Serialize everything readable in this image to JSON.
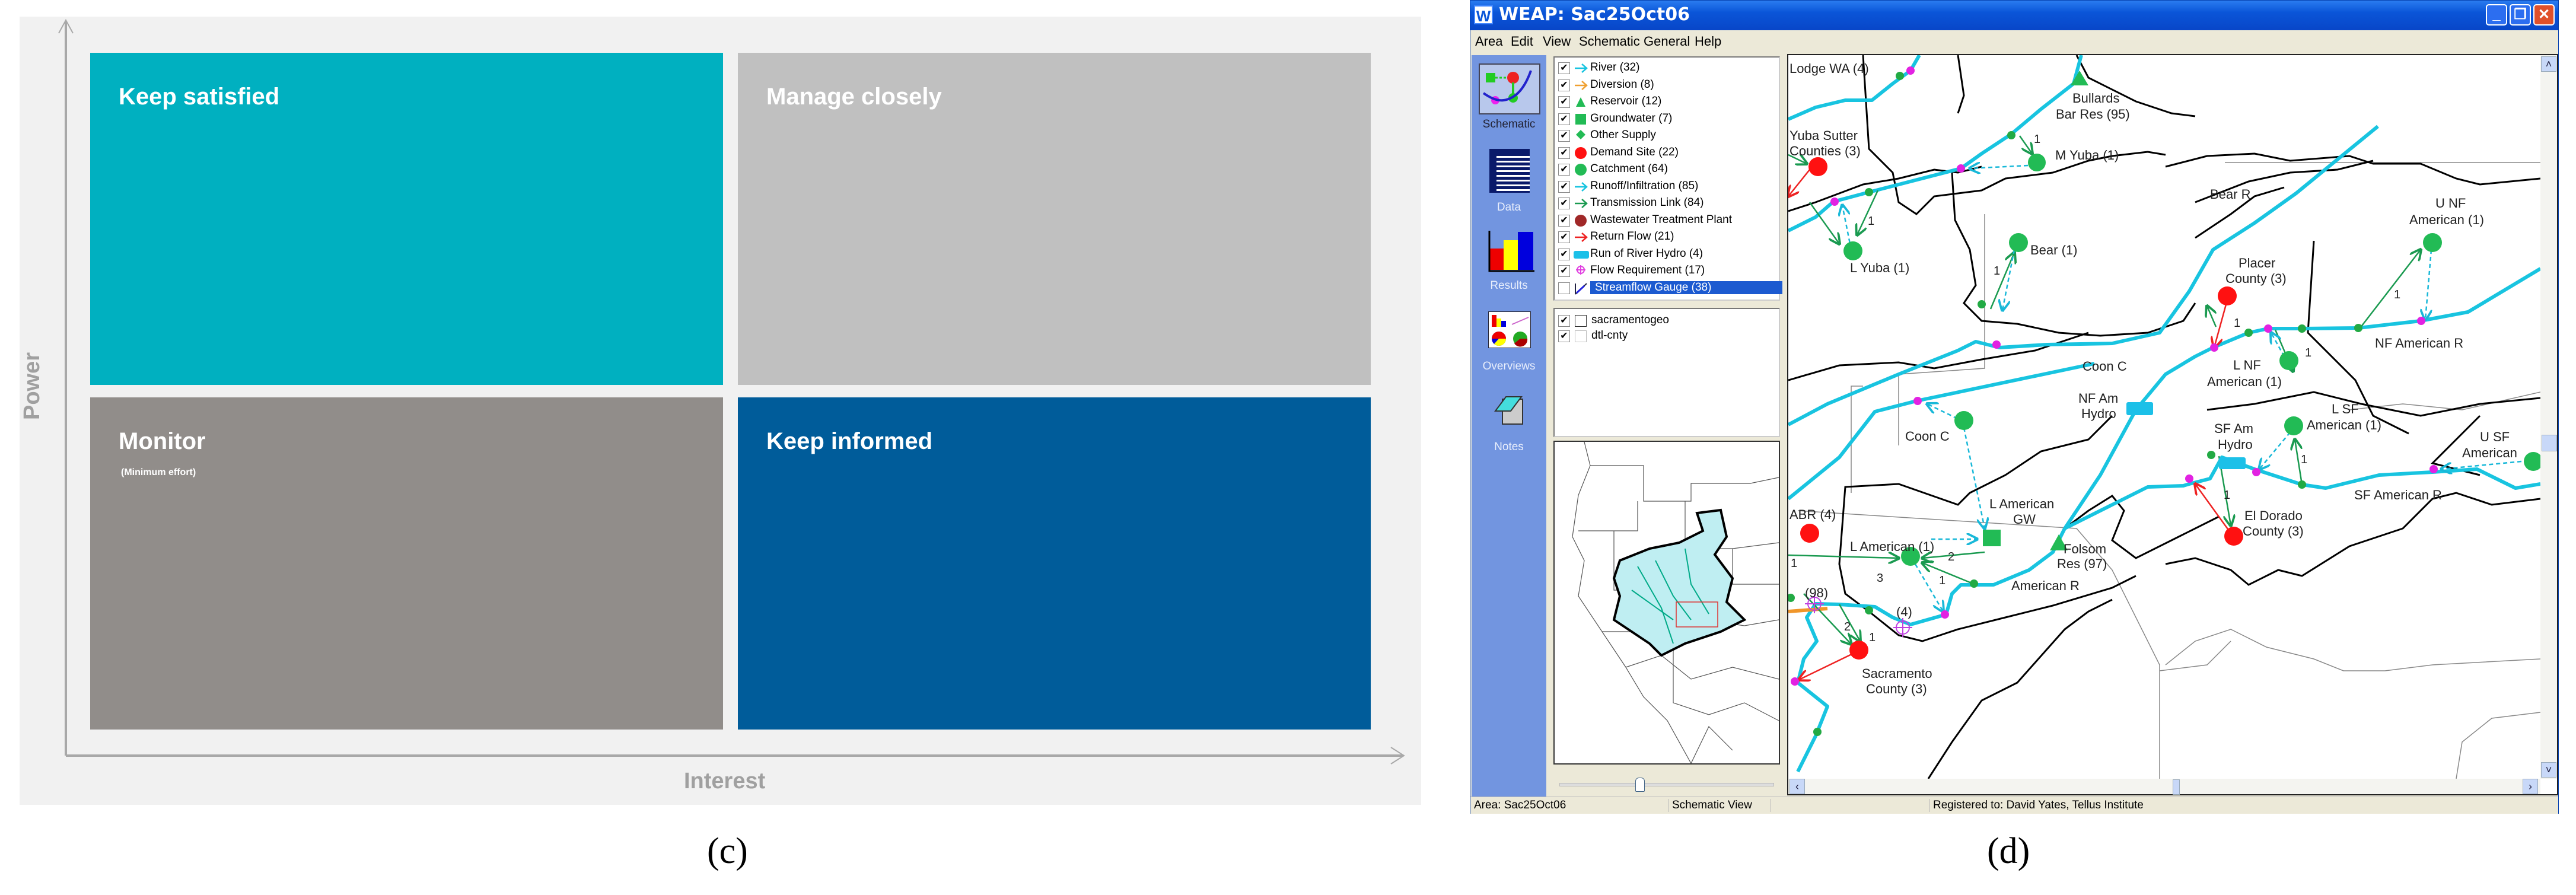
{
  "panel_c": {
    "caption": "(c)",
    "y_axis_label": "Power",
    "x_axis_label": "Interest",
    "quadrants": {
      "keep_satisfied": {
        "title": "Keep satisfied",
        "color": "#00b0c0"
      },
      "manage_closely": {
        "title": "Manage closely",
        "color": "#c0c0c0"
      },
      "monitor": {
        "title": "Monitor",
        "subtitle": "(Minimum effort)",
        "color": "#918d8a"
      },
      "keep_informed": {
        "title": "Keep informed",
        "color": "#005c9a"
      }
    }
  },
  "panel_d": {
    "caption": "(d)",
    "window": {
      "app_icon": "W",
      "title": "WEAP: Sac25Oct06",
      "menu": [
        "Area",
        "Edit",
        "View",
        "Schematic",
        "General",
        "Help"
      ]
    },
    "sidebar": [
      "Schematic",
      "Data",
      "Results",
      "Overviews",
      "Notes"
    ],
    "legend": [
      {
        "label": "River (32)",
        "icon": "arrow-cyan-icon",
        "checked": true
      },
      {
        "label": "Diversion (8)",
        "icon": "arrow-orange-icon",
        "checked": true
      },
      {
        "label": "Reservoir (12)",
        "icon": "triangle-green-icon",
        "checked": true
      },
      {
        "label": "Groundwater (7)",
        "icon": "square-green-icon",
        "checked": true
      },
      {
        "label": "Other Supply",
        "icon": "diamond-green-icon",
        "checked": true
      },
      {
        "label": "Demand Site (22)",
        "icon": "circle-red-icon",
        "checked": true
      },
      {
        "label": "Catchment (64)",
        "icon": "circle-green-icon",
        "checked": true
      },
      {
        "label": "Runoff/Infiltration (85)",
        "icon": "arrow-cyan-icon",
        "checked": true
      },
      {
        "label": "Transmission Link (84)",
        "icon": "arrow-green-icon",
        "checked": true
      },
      {
        "label": "Wastewater Treatment Plant",
        "icon": "circle-darkred-icon",
        "checked": true
      },
      {
        "label": "Return Flow (21)",
        "icon": "arrow-red-icon",
        "checked": true
      },
      {
        "label": "Run of River Hydro (4)",
        "icon": "rect-cyan-icon",
        "checked": true
      },
      {
        "label": "Flow Requirement (17)",
        "icon": "crosshair-magenta-icon",
        "checked": true
      },
      {
        "label": "Streamflow Gauge (38)",
        "icon": "gauge-icon",
        "checked": false,
        "selected": true
      }
    ],
    "layers": [
      {
        "label": "sacramentogeo",
        "checked": true
      },
      {
        "label": "dtl-cnty",
        "checked": true
      }
    ],
    "map": {
      "labels": {
        "lodge_wa": "Lodge WA (4)",
        "bullards": [
          "Bullards",
          "Bar Res (95)"
        ],
        "yuba_sutter": [
          "Yuba Sutter",
          "Counties (3)"
        ],
        "m_yuba": "M Yuba (1)",
        "l_yuba": "L Yuba (1)",
        "bear": "Bear (1)",
        "bear_r": "Bear R",
        "u_nf": [
          "U NF",
          "American (1)"
        ],
        "placer": [
          "Placer",
          "County (3)"
        ],
        "l_nf": [
          "L NF",
          "American (1)"
        ],
        "nf_american_r": "NF American R",
        "coon_c_river": "Coon C",
        "nf_am_hydro": [
          "NF Am",
          "Hydro"
        ],
        "coon_c": "Coon C",
        "l_american_gw": [
          "L American",
          "GW"
        ],
        "abr": "ABR (4)",
        "l_american": "L American (1)",
        "folsom": [
          "Folsom",
          "Res (97)"
        ],
        "american_r": "American R",
        "fr98": "(98)",
        "fr4": "(4)",
        "sacramento": [
          "Sacramento",
          "County (3)"
        ],
        "l_sf": [
          "L SF",
          "American (1)"
        ],
        "sf_am_hydro": [
          "SF Am",
          "Hydro"
        ],
        "u_sf": [
          "U SF",
          "American"
        ],
        "sf_american_r": "SF American R",
        "el_dorado": [
          "El Dorado",
          "County (3)"
        ]
      },
      "link_numbers": [
        "1",
        "1",
        "1",
        "1",
        "1",
        "1",
        "1",
        "3",
        "2",
        "1",
        "2",
        "1",
        "1",
        "1"
      ]
    },
    "status": {
      "area": "Area: Sac25Oct06",
      "view": "Schematic View",
      "registered": "Registered to: David Yates, Tellus Institute"
    }
  }
}
